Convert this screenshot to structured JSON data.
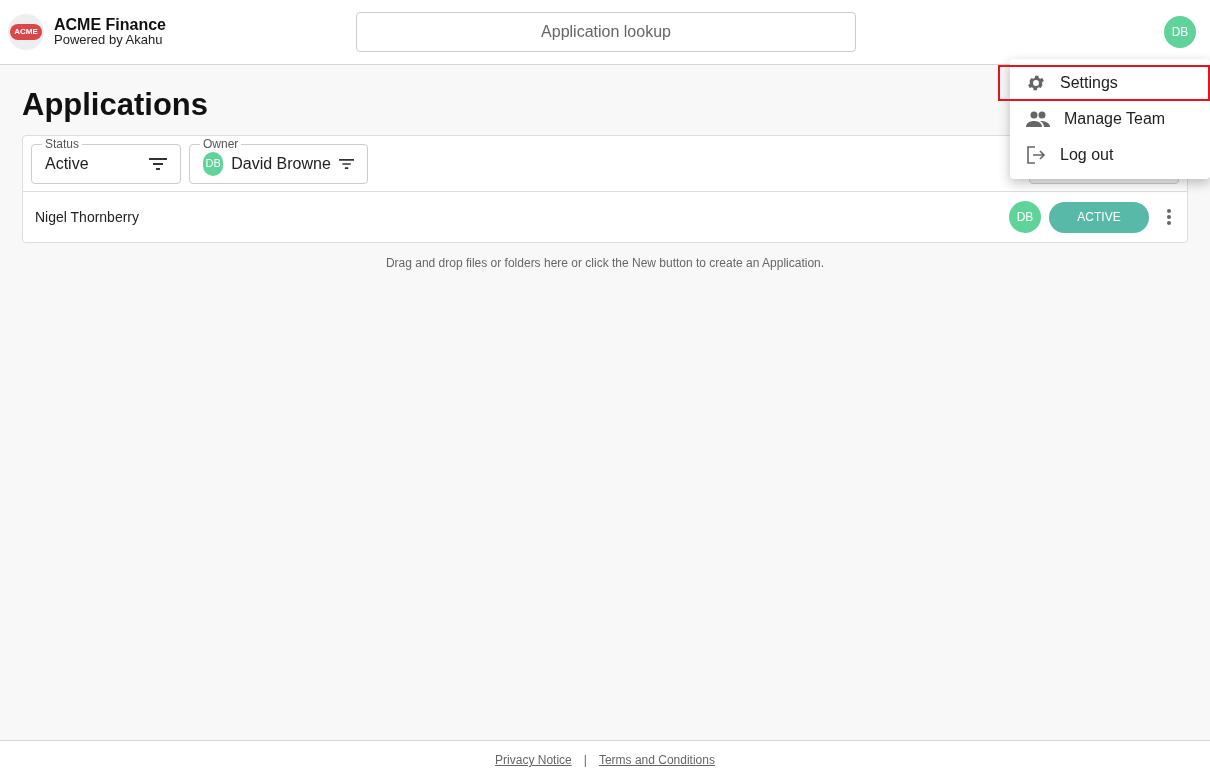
{
  "header": {
    "logo_text": "ACME",
    "title": "ACME Finance",
    "subtitle": "Powered by Akahu",
    "search": {
      "placeholder": "Application lookup"
    },
    "avatar": "DB"
  },
  "page_title": "Applications",
  "filters": [
    {
      "kind": "text",
      "label": "Status",
      "value": "Active"
    },
    {
      "kind": "avatar",
      "label": "Owner",
      "avatar": "DB",
      "value": "David Browne"
    }
  ],
  "rows": [
    {
      "name": "Nigel Thornberry",
      "avatar": "DB",
      "status": "ACTIVE"
    }
  ],
  "hint": "Drag and drop files or folders here or click the New button to create an Application.",
  "menu": [
    {
      "kind": "gear",
      "label": "Settings",
      "highlighted": true
    },
    {
      "kind": "people",
      "label": "Manage Team",
      "highlighted": false
    },
    {
      "kind": "logout",
      "label": "Log out",
      "highlighted": false
    }
  ],
  "footer": {
    "links": [
      "Privacy Notice",
      "Terms and Conditions"
    ],
    "separator": "|"
  }
}
